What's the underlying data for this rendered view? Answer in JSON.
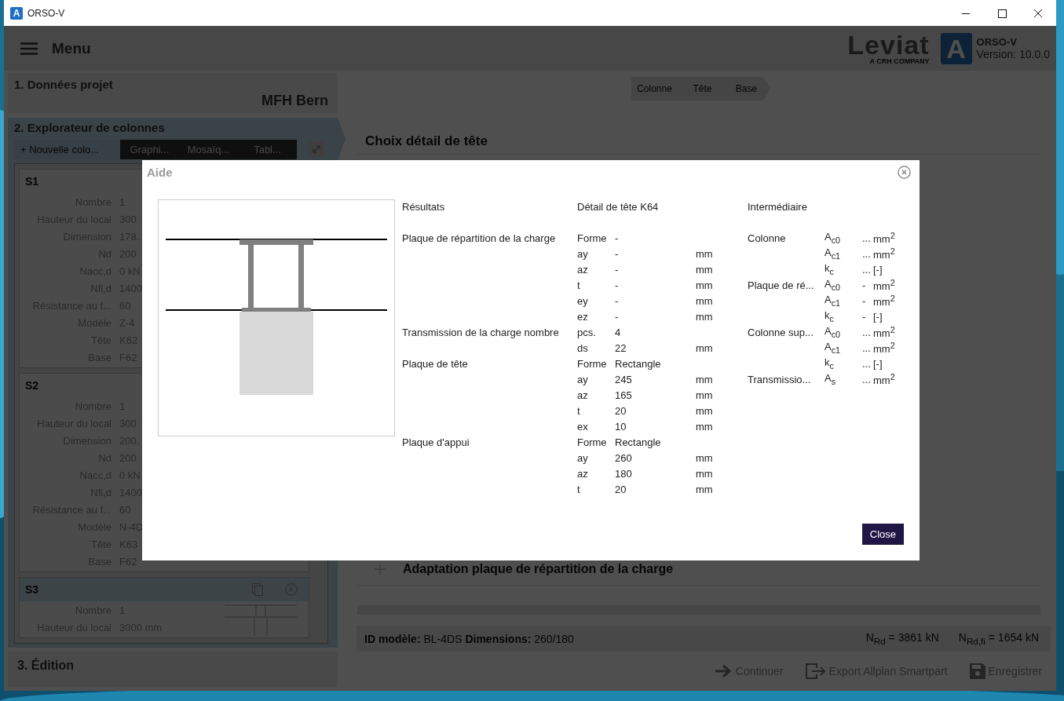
{
  "window": {
    "title": "ORSO-V",
    "logo_letter": "A"
  },
  "header": {
    "menu_label": "Menu",
    "brand": "Leviat",
    "brand_tagline": "A CRH COMPANY",
    "app_logo_letter": "A",
    "app_name": "ORSO-V",
    "version": "Version: 10.0.0"
  },
  "sidebar": {
    "project": {
      "title": "1. Données projet",
      "name": "MFH Bern"
    },
    "explorer": {
      "title": "2. Explorateur de colonnes",
      "new_button": "+ Nouvelle colo...",
      "view_tabs": [
        "Graphi...",
        "Mosaïq...",
        "Tabl..."
      ],
      "columns": [
        {
          "name": "S1",
          "highlighted": false,
          "rows": [
            {
              "label": "Nombre",
              "value": "1"
            },
            {
              "label": "Hauteur du local",
              "value": "300"
            },
            {
              "label": "Dimension",
              "value": "178."
            },
            {
              "label": "Nd",
              "value": "200"
            },
            {
              "label": "Nacc,d",
              "value": "0 kN"
            },
            {
              "label": "Nfi,d",
              "value": "1400"
            },
            {
              "label": "Résistance au f...",
              "value": "60"
            },
            {
              "label": "Modèle",
              "value": "Z-4"
            },
            {
              "label": "Tête",
              "value": "K62"
            },
            {
              "label": "Base",
              "value": "F62"
            }
          ]
        },
        {
          "name": "S2",
          "highlighted": false,
          "rows": [
            {
              "label": "Nombre",
              "value": "1"
            },
            {
              "label": "Hauteur du local",
              "value": "300"
            },
            {
              "label": "Dimension",
              "value": "200."
            },
            {
              "label": "Nd",
              "value": "200"
            },
            {
              "label": "Nacc,d",
              "value": "0 kN"
            },
            {
              "label": "Nfi,d",
              "value": "1400"
            },
            {
              "label": "Résistance au f...",
              "value": "60"
            },
            {
              "label": "Modèle",
              "value": "N-4D"
            },
            {
              "label": "Tête",
              "value": "K63"
            },
            {
              "label": "Base",
              "value": "F62"
            }
          ]
        },
        {
          "name": "S3",
          "highlighted": true,
          "rows": [
            {
              "label": "Nombre",
              "value": "1"
            },
            {
              "label": "Hauteur du local",
              "value": "3000 mm"
            }
          ]
        }
      ]
    },
    "edition": {
      "title": "3. Édition"
    }
  },
  "main": {
    "steps": [
      "Colonne",
      "Tête",
      "Base"
    ],
    "section_title": "Choix détail de tête",
    "expander": {
      "label": "Adaptation plaque de répartition de la charge",
      "expanded": false
    },
    "status": {
      "model": "**ID modèle:** BL-4DS **Dimensions:** 260/180",
      "n_rd": "N$_{Rd}$ = 3861 kN",
      "n_rd_fi": "N$_{Rd,fi}$ = 1654 kN"
    },
    "actions": [
      {
        "kind": "continue",
        "label": "Continuer"
      },
      {
        "kind": "export",
        "label": "Export Allplan Smartpart"
      },
      {
        "kind": "save",
        "label": "Enregistrer"
      }
    ]
  },
  "modal": {
    "title": "Aide",
    "close_button": "Close",
    "results": {
      "heading": "Résultats",
      "detail_heading": "Détail de tête K64",
      "groups": [
        {
          "label": "Plaque de répartition de la charge",
          "rows": [
            {
              "param": "Forme",
              "value": "-"
            },
            {
              "param": "ay",
              "value": "-",
              "unit": "mm"
            },
            {
              "param": "az",
              "value": "-",
              "unit": "mm"
            },
            {
              "param": "t",
              "value": "-",
              "unit": "mm"
            },
            {
              "param": "ey",
              "value": "-",
              "unit": "mm"
            },
            {
              "param": "ez",
              "value": "-",
              "unit": "mm"
            }
          ]
        },
        {
          "label": "Transmission de la charge nombre",
          "rows": [
            {
              "param": "pcs.",
              "value": "4"
            },
            {
              "param": "ds",
              "value": "22",
              "unit": "mm"
            }
          ]
        },
        {
          "label": "Plaque de tête",
          "rows": [
            {
              "param": "Forme",
              "value": "Rectangle"
            },
            {
              "param": "ay",
              "value": "245",
              "unit": "mm"
            },
            {
              "param": "az",
              "value": "165",
              "unit": "mm"
            },
            {
              "param": "t",
              "value": "20",
              "unit": "mm"
            },
            {
              "param": "ex",
              "value": "10",
              "unit": "mm"
            }
          ]
        },
        {
          "label": "Plaque d'appui",
          "rows": [
            {
              "param": "Forme",
              "value": "Rectangle"
            },
            {
              "param": "ay",
              "value": "260",
              "unit": "mm"
            },
            {
              "param": "az",
              "value": "180",
              "unit": "mm"
            },
            {
              "param": "t",
              "value": "20",
              "unit": "mm"
            }
          ]
        }
      ]
    },
    "intermediate": {
      "heading": "Intermédiaire",
      "groups": [
        {
          "label": "Colonne",
          "rows": [
            {
              "symbol": "A$_{c0}$",
              "value": "...",
              "unit": "mm$^{2}$"
            },
            {
              "symbol": "A$_{c1}$",
              "value": "...",
              "unit": "mm$^{2}$"
            },
            {
              "symbol": "k$_{c}$",
              "value": "...",
              "unit": "[-]"
            }
          ]
        },
        {
          "label": "Plaque de ré...",
          "rows": [
            {
              "symbol": "A$_{c0}$",
              "value": "-",
              "unit": "mm$^{2}$"
            },
            {
              "symbol": "A$_{c1}$",
              "value": "-",
              "unit": "mm$^{2}$"
            },
            {
              "symbol": "k$_{c}$",
              "value": "-",
              "unit": "[-]"
            }
          ]
        },
        {
          "label": "Colonne sup...",
          "rows": [
            {
              "symbol": "A$_{c0}$",
              "value": "...",
              "unit": "mm$^{2}$"
            },
            {
              "symbol": "A$_{c1}$",
              "value": "...",
              "unit": "mm$^{2}$"
            },
            {
              "symbol": "k$_{c}$",
              "value": "...",
              "unit": "[-]"
            }
          ]
        },
        {
          "label": "Transmissio...",
          "rows": [
            {
              "symbol": "A$_{s}$",
              "value": "...",
              "unit": "mm$^{2}$"
            }
          ]
        }
      ]
    }
  }
}
